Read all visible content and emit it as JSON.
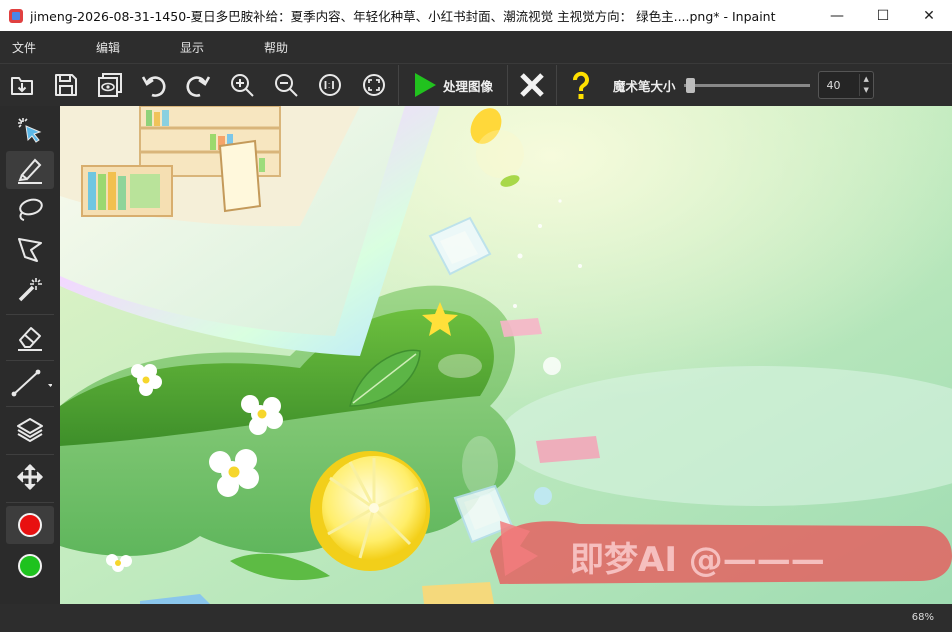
{
  "window": {
    "title": "jimeng-2026-08-31-1450-夏日多巴胺补给：夏季内容、年轻化种草、小红书封面、潮流视觉 主视觉方向： 绿色主....png* - Inpaint",
    "minimize_glyph": "—",
    "maximize_glyph": "☐",
    "close_glyph": "✕"
  },
  "menu": [
    "文件",
    "编辑",
    "显示",
    "帮助"
  ],
  "toolbar": {
    "process_label": "处理图像",
    "brush_size_label": "魔术笔大小",
    "brush_size_value": "40",
    "brush_slider_fraction": 0.02,
    "icons": [
      "open-icon",
      "save-icon",
      "preview-icon",
      "undo-icon",
      "redo-icon",
      "zoom-in-icon",
      "zoom-out-icon",
      "actual-size-icon",
      "fit-screen-icon",
      "play-icon",
      "cancel-icon",
      "help-icon"
    ]
  },
  "tools": [
    "select-arrow",
    "marker",
    "lasso",
    "polygon-lasso",
    "magic-wand",
    "eraser",
    "line",
    "layers",
    "move",
    "red-color",
    "green-color"
  ],
  "colors": {
    "primary_color": "#e81010",
    "secondary_color": "#1ec21e",
    "play_green": "#21c21e",
    "help_yellow": "#ffe000",
    "watermark_red": "#e8575a"
  },
  "canvas": {
    "watermark_text": "即梦AI @———"
  },
  "status": {
    "zoom": "68%"
  }
}
